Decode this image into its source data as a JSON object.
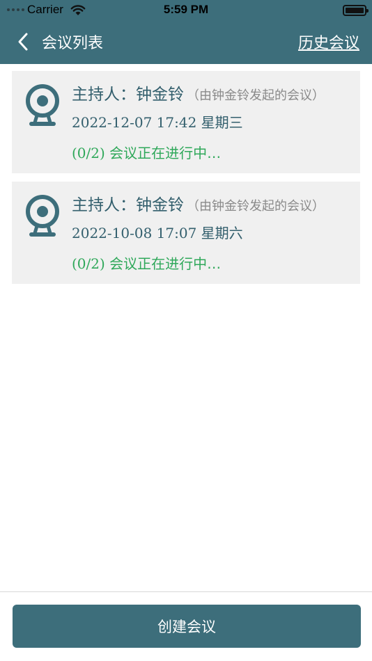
{
  "status_bar": {
    "carrier": "Carrier",
    "time": "5:59 PM"
  },
  "nav": {
    "title": "会议列表",
    "history_link": "历史会议"
  },
  "meetings": [
    {
      "host_label": "主持人：",
      "host_name": "钟金铃",
      "host_note": "（由钟金铃发起的会议）",
      "datetime": "2022-12-07 17:42",
      "weekday": "星期三",
      "count": "(0/2)",
      "status": "会议正在进行中…"
    },
    {
      "host_label": "主持人：",
      "host_name": "钟金铃",
      "host_note": "（由钟金铃发起的会议）",
      "datetime": "2022-10-08 17:07",
      "weekday": "星期六",
      "count": "(0/2)",
      "status": "会议正在进行中…"
    }
  ],
  "footer": {
    "create_button": "创建会议"
  },
  "colors": {
    "header": "#3d6e7b",
    "accent_text": "#335f6d",
    "status_green": "#2fa85a",
    "card_bg": "#f0f0f0"
  }
}
